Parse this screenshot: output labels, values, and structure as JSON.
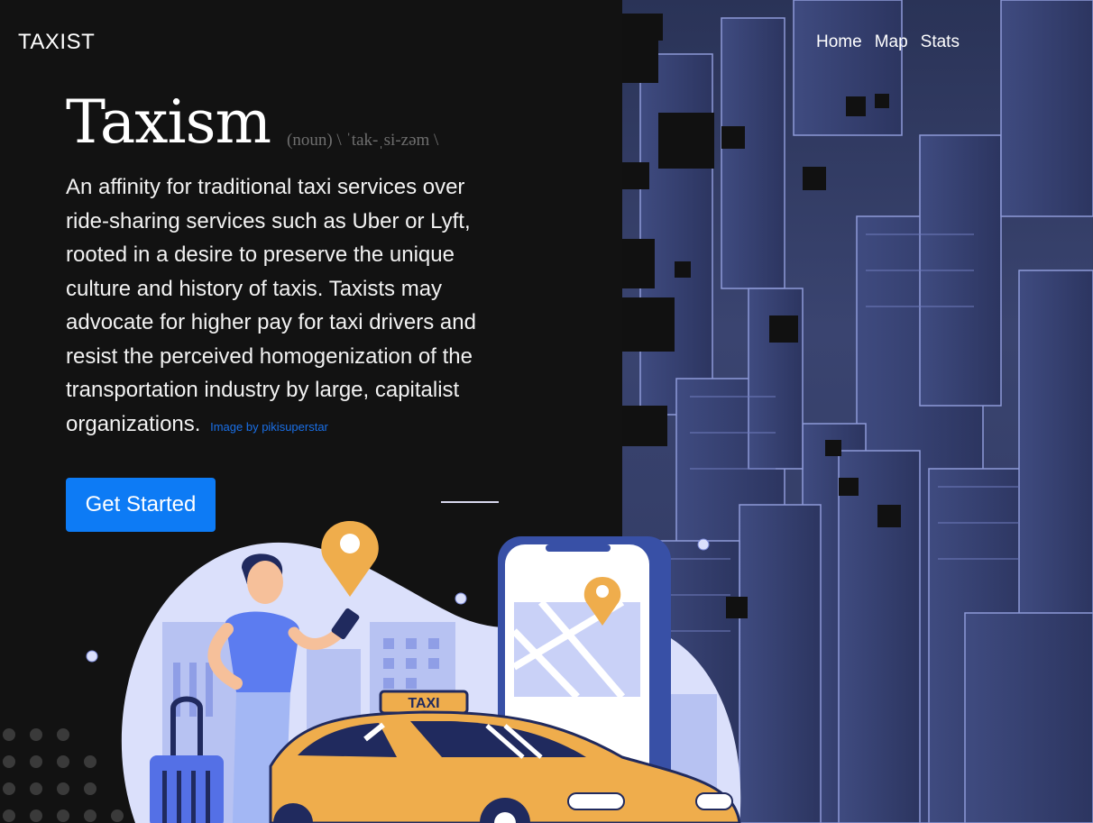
{
  "navbar": {
    "brand": "TAXIST",
    "links": [
      {
        "label": "Home"
      },
      {
        "label": "Map"
      },
      {
        "label": "Stats"
      }
    ]
  },
  "hero": {
    "title": "Taxism",
    "pronunciation": "(noun) \\ ˈtak-ˌsi-zəm \\",
    "description": "An affinity for traditional taxi services over ride-sharing services such as Uber or Lyft, rooted in a desire to preserve the unique culture and history of taxis. Taxists may advocate for higher pay for taxi drivers and resist the perceived homogenization of the transportation industry by large, capitalist organizations.",
    "image_credit": "Image by pikisuperstar",
    "cta_label": "Get Started"
  },
  "illustration": {
    "taxi_sign": "TAXI"
  },
  "colors": {
    "background": "#121212",
    "accent": "#0d7bf5",
    "taxi_yellow": "#efad4c",
    "city_blue": "#343d66"
  }
}
